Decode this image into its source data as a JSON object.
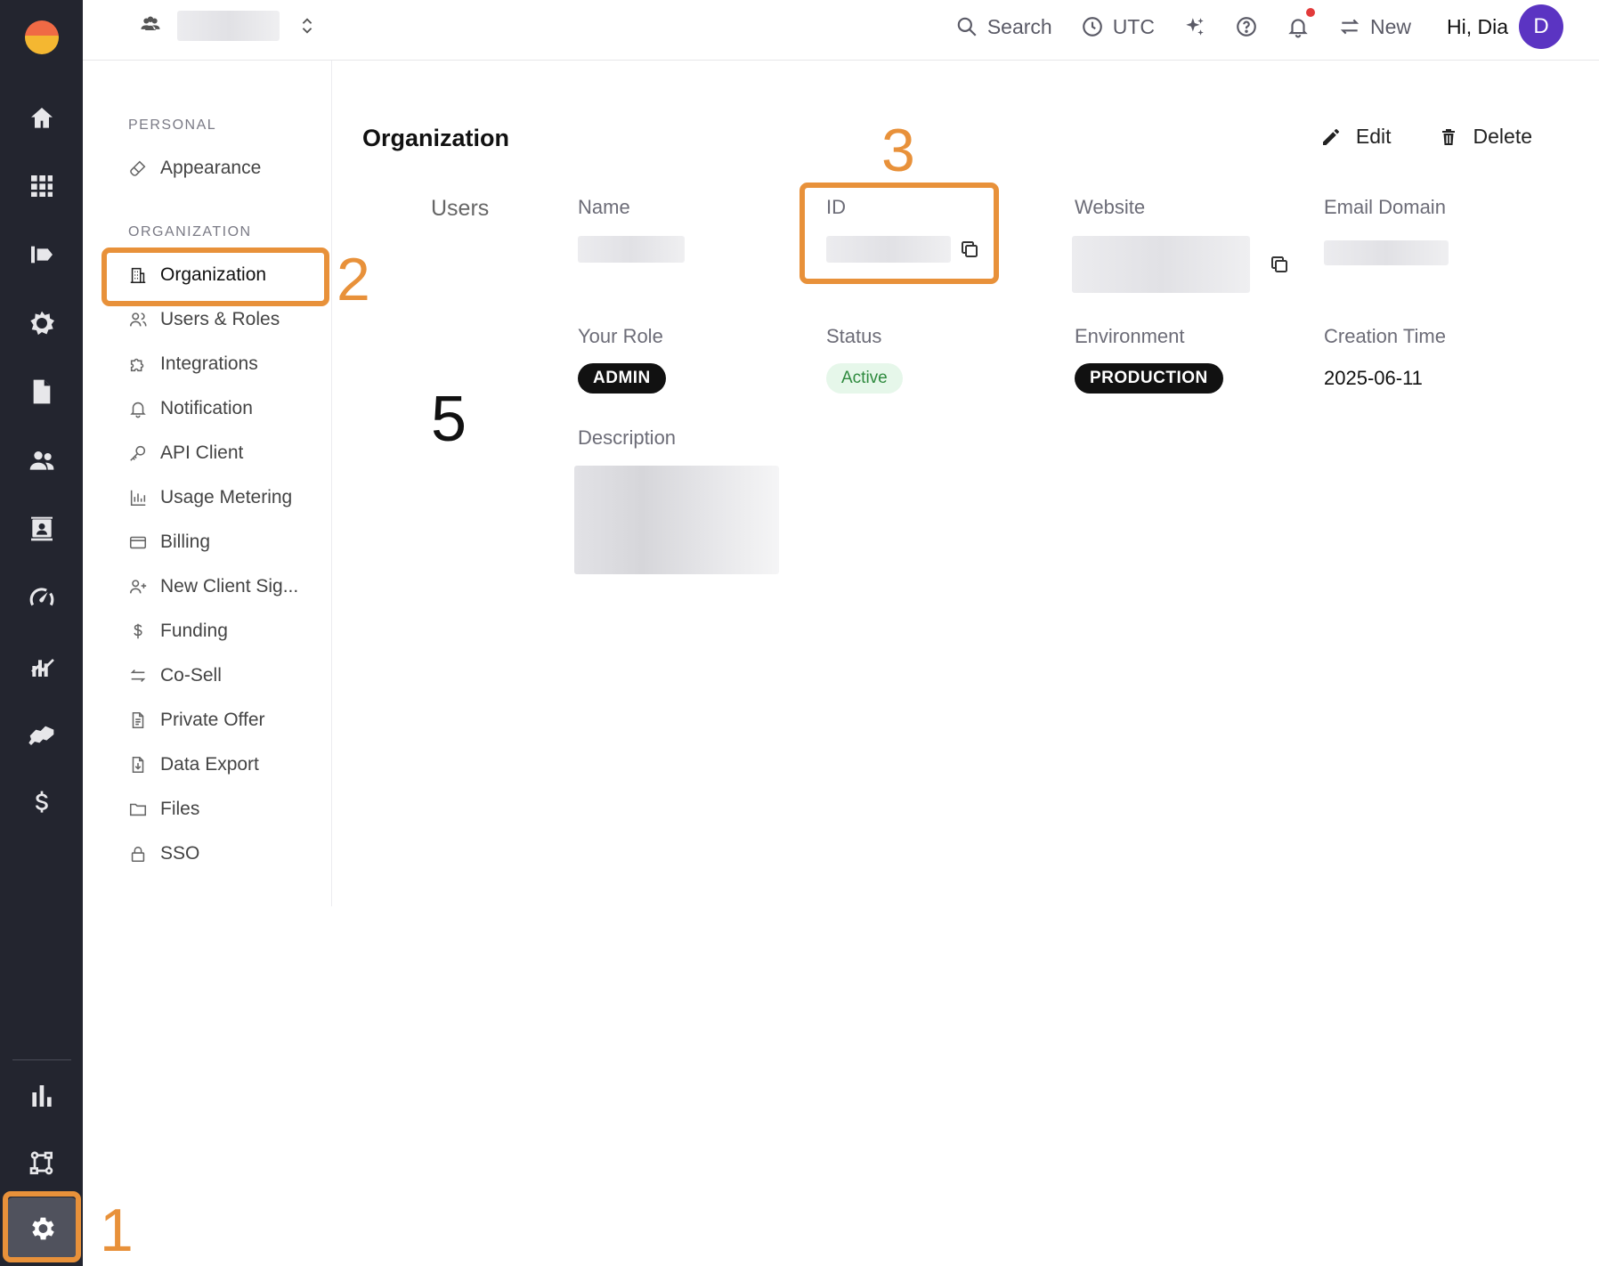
{
  "topbar": {
    "search_label": "Search",
    "timezone_label": "UTC",
    "new_label": "New",
    "greeting": "Hi, Dia",
    "avatar_initial": "D"
  },
  "subnav": {
    "personal_heading": "PERSONAL",
    "organization_heading": "ORGANIZATION",
    "personal_items": [
      {
        "label": "Appearance",
        "icon": "brush-icon"
      }
    ],
    "org_items": [
      {
        "label": "Organization",
        "icon": "building-icon",
        "active": true
      },
      {
        "label": "Users & Roles",
        "icon": "users-icon"
      },
      {
        "label": "Integrations",
        "icon": "puzzle-icon"
      },
      {
        "label": "Notification",
        "icon": "bell-icon"
      },
      {
        "label": "API Client",
        "icon": "key-icon"
      },
      {
        "label": "Usage Metering",
        "icon": "bar-chart-icon"
      },
      {
        "label": "Billing",
        "icon": "credit-card-icon"
      },
      {
        "label": "New Client Sig...",
        "icon": "user-plus-icon"
      },
      {
        "label": "Funding",
        "icon": "dollar-icon"
      },
      {
        "label": "Co-Sell",
        "icon": "arrows-swap-icon"
      },
      {
        "label": "Private Offer",
        "icon": "document-icon"
      },
      {
        "label": "Data Export",
        "icon": "file-download-icon"
      },
      {
        "label": "Files",
        "icon": "folder-icon"
      },
      {
        "label": "SSO",
        "icon": "lock-icon"
      }
    ]
  },
  "main": {
    "title": "Organization",
    "edit_label": "Edit",
    "delete_label": "Delete",
    "tab_users": "Users",
    "fields": {
      "name_label": "Name",
      "id_label": "ID",
      "website_label": "Website",
      "email_domain_label": "Email Domain",
      "role_label": "Your Role",
      "role_value": "ADMIN",
      "status_label": "Status",
      "status_value": "Active",
      "environment_label": "Environment",
      "environment_value": "PRODUCTION",
      "creation_time_label": "Creation Time",
      "creation_time_value": "2025-06-11",
      "description_label": "Description"
    }
  },
  "annotations": {
    "one": "1",
    "two": "2",
    "three": "3",
    "five": "5"
  },
  "colors": {
    "rail": "#23252f",
    "annotation": "#e8913a",
    "avatar": "#5b34c2",
    "active_status_bg": "#e6f7ea",
    "active_status_text": "#2e8a3e"
  }
}
